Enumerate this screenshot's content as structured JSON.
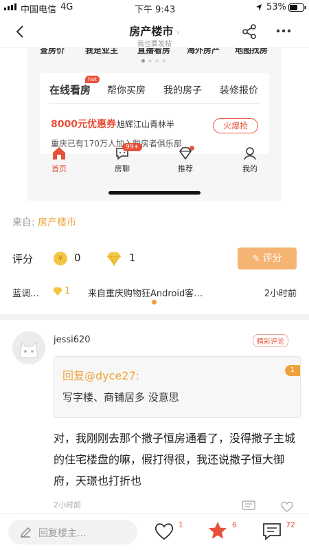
{
  "status_bar": {
    "carrier": "中国电信",
    "network": "4G",
    "time": "下午 9:43",
    "battery": "53%"
  },
  "nav": {
    "title": "房产楼市",
    "subtitle": "我也要发帖"
  },
  "screenshot": {
    "top_row": [
      "查房价",
      "我是业主",
      "直播看房",
      "海外房产",
      "地图找房"
    ],
    "tabs": [
      "在线看房",
      "帮你买房",
      "我的房子",
      "装修报价"
    ],
    "hot_badge": "hot",
    "coupon_title": "8000元优惠券",
    "coupon_subtitle": "旭辉江山青林半",
    "coupon_button": "火爆抢",
    "club_text": "重庆已有170万人加入购房者俱乐部",
    "bottom_nav": [
      {
        "label": "首页",
        "icon": "home-icon"
      },
      {
        "label": "房聊",
        "icon": "chat-icon",
        "badge": "99+"
      },
      {
        "label": "推荐",
        "icon": "diamond-icon"
      },
      {
        "label": "我的",
        "icon": "profile-icon"
      }
    ]
  },
  "source": {
    "prefix": "来自:",
    "forum": "房产楼市"
  },
  "rating": {
    "label": "评分",
    "coin_symbol": "¥",
    "coin_count": "0",
    "gem_count": "1",
    "button": "评分"
  },
  "meta": {
    "user": "蓝调…",
    "gem": "1",
    "from": "来自重庆购物狂Android客…",
    "time": "2小时前"
  },
  "comment": {
    "username": "jessi620",
    "tag": "精彩评论",
    "quote_header": "回复@dyce27:",
    "quote_text": "写字楼、商铺居多 没意思",
    "quote_badge": "1",
    "body": "对，我刚刚去那个撒子恒房通看了，没得撒子主城的住宅楼盘的嘛，假打得很，我还说撒子恒大御府，天璟也打折也",
    "time": "2小时前"
  },
  "footer": {
    "placeholder": "回复楼主...",
    "like_count": "1",
    "fav_count": "6",
    "comment_count": "72"
  },
  "colors": {
    "accent": "#f0a23a",
    "red": "#e8503a",
    "button": "#f6b473"
  }
}
